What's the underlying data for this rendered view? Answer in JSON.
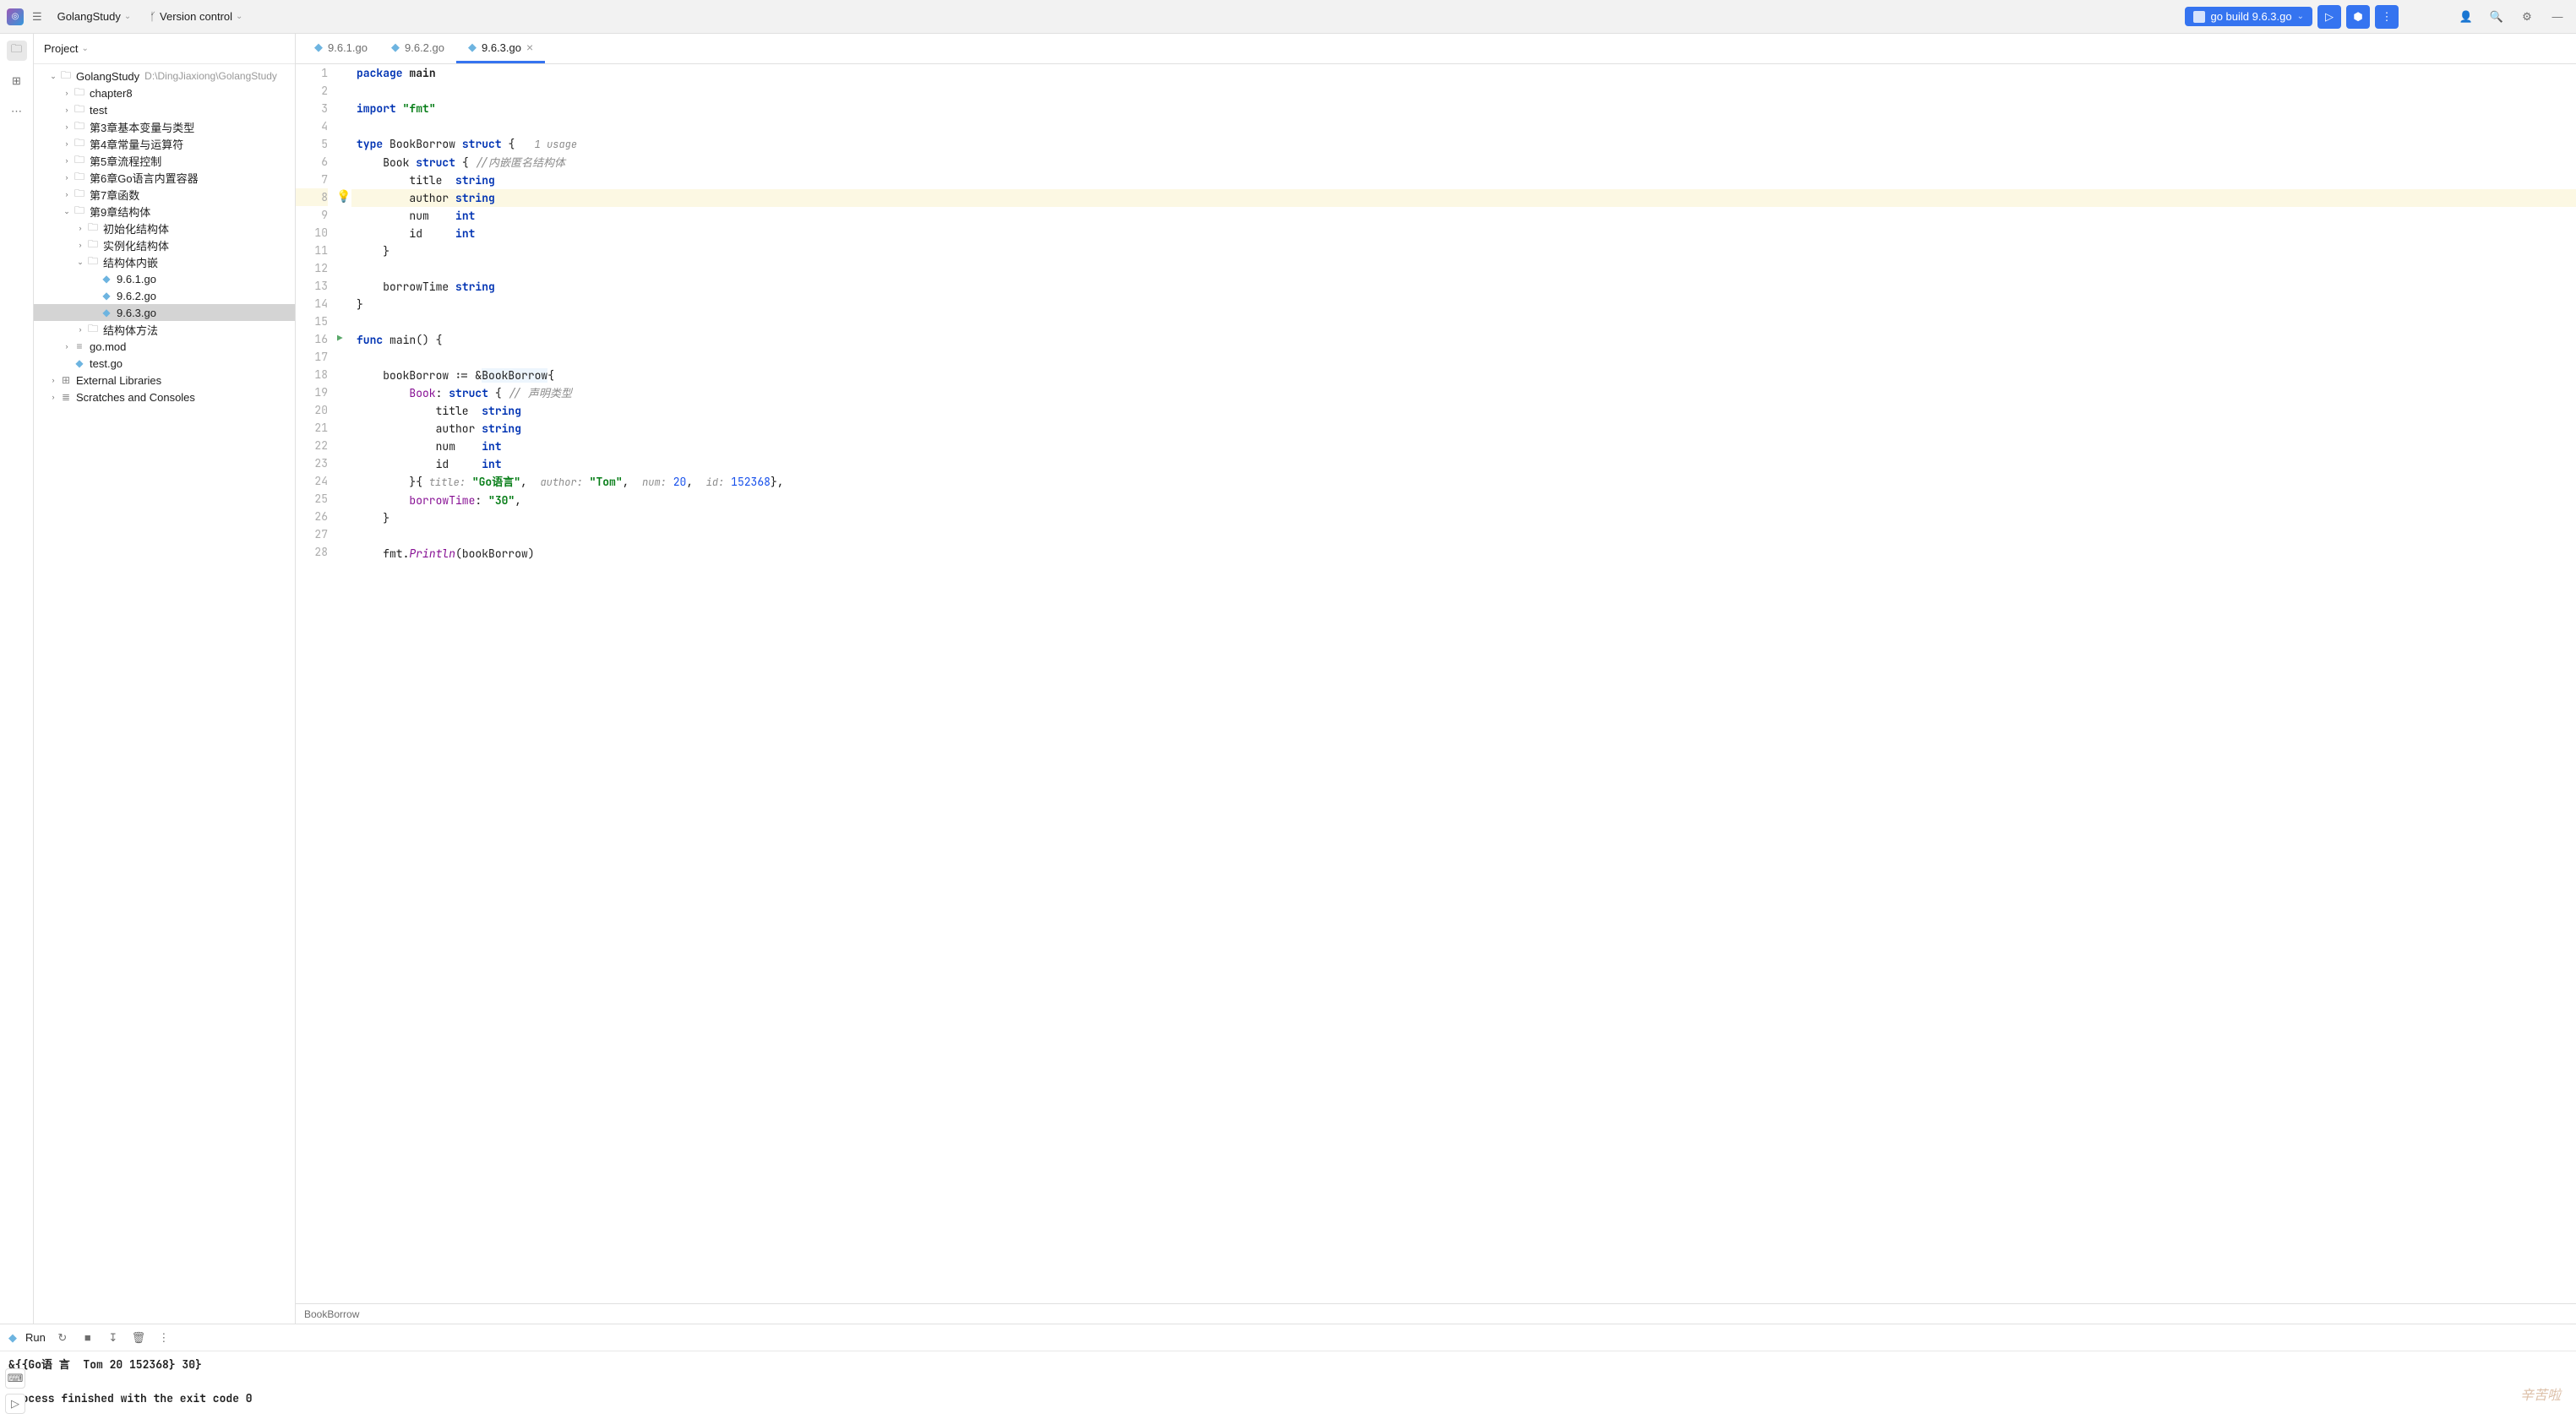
{
  "toolbar": {
    "project_name": "GolangStudy",
    "vcs_label": "Version control",
    "run_config": "go build 9.6.3.go"
  },
  "project_panel": {
    "title": "Project",
    "root": {
      "name": "GolangStudy",
      "path": "D:\\DingJiaxiong\\GolangStudy"
    },
    "tree": [
      {
        "depth": 1,
        "arrow": "v",
        "icon": "folder",
        "label": "GolangStudy",
        "hint": "D:\\DingJiaxiong\\GolangStudy"
      },
      {
        "depth": 2,
        "arrow": ">",
        "icon": "folder",
        "label": "chapter8"
      },
      {
        "depth": 2,
        "arrow": ">",
        "icon": "folder",
        "label": "test"
      },
      {
        "depth": 2,
        "arrow": ">",
        "icon": "folder",
        "label": "第3章基本变量与类型"
      },
      {
        "depth": 2,
        "arrow": ">",
        "icon": "folder",
        "label": "第4章常量与运算符"
      },
      {
        "depth": 2,
        "arrow": ">",
        "icon": "folder",
        "label": "第5章流程控制"
      },
      {
        "depth": 2,
        "arrow": ">",
        "icon": "folder",
        "label": "第6章Go语言内置容器"
      },
      {
        "depth": 2,
        "arrow": ">",
        "icon": "folder",
        "label": "第7章函数"
      },
      {
        "depth": 2,
        "arrow": "v",
        "icon": "folder",
        "label": "第9章结构体"
      },
      {
        "depth": 3,
        "arrow": ">",
        "icon": "folder",
        "label": "初始化结构体"
      },
      {
        "depth": 3,
        "arrow": ">",
        "icon": "folder",
        "label": "实例化结构体"
      },
      {
        "depth": 3,
        "arrow": "v",
        "icon": "folder",
        "label": "结构体内嵌"
      },
      {
        "depth": 4,
        "arrow": "",
        "icon": "go",
        "label": "9.6.1.go"
      },
      {
        "depth": 4,
        "arrow": "",
        "icon": "go",
        "label": "9.6.2.go"
      },
      {
        "depth": 4,
        "arrow": "",
        "icon": "go",
        "label": "9.6.3.go",
        "selected": true
      },
      {
        "depth": 3,
        "arrow": ">",
        "icon": "folder",
        "label": "结构体方法"
      },
      {
        "depth": 2,
        "arrow": ">",
        "icon": "mod",
        "label": "go.mod"
      },
      {
        "depth": 2,
        "arrow": "",
        "icon": "go",
        "label": "test.go"
      },
      {
        "depth": 1,
        "arrow": ">",
        "icon": "lib",
        "label": "External Libraries"
      },
      {
        "depth": 1,
        "arrow": ">",
        "icon": "scratch",
        "label": "Scratches and Consoles"
      }
    ]
  },
  "tabs": [
    {
      "label": "9.6.1.go",
      "active": false
    },
    {
      "label": "9.6.2.go",
      "active": false
    },
    {
      "label": "9.6.3.go",
      "active": true
    }
  ],
  "code": {
    "lines": [
      {
        "n": 1,
        "html": "<span class='kw'>package</span> <span class='pkg'>main</span>"
      },
      {
        "n": 2,
        "html": ""
      },
      {
        "n": 3,
        "html": "<span class='kw'>import</span> <span class='str'>\"fmt\"</span>"
      },
      {
        "n": 4,
        "html": ""
      },
      {
        "n": 5,
        "html": "<span class='kw'>type</span> <span class='ident'>BookBorrow</span> <span class='kw'>struct</span> {   <span class='hint'>1 usage</span>"
      },
      {
        "n": 6,
        "html": "    <span class='ident'>Book</span> <span class='kw'>struct</span> { <span class='comm'>//内嵌匿名结构体</span>"
      },
      {
        "n": 7,
        "html": "        <span class='ident'>title</span>  <span class='type'>string</span>"
      },
      {
        "n": 8,
        "html": "        <span class='ident'>author</span> <span class='type'>string</span>",
        "hl": true,
        "bulb": true
      },
      {
        "n": 9,
        "html": "        <span class='ident'>num</span>    <span class='type'>int</span>"
      },
      {
        "n": 10,
        "html": "        <span class='ident'>id</span>     <span class='type'>int</span>"
      },
      {
        "n": 11,
        "html": "    }"
      },
      {
        "n": 12,
        "html": ""
      },
      {
        "n": 13,
        "html": "    <span class='ident'>borrowTime</span> <span class='type'>string</span>"
      },
      {
        "n": 14,
        "html": "}"
      },
      {
        "n": 15,
        "html": ""
      },
      {
        "n": 16,
        "html": "<span class='kw'>func</span> <span class='ident'>main</span>() {",
        "run": true
      },
      {
        "n": 17,
        "html": ""
      },
      {
        "n": 18,
        "html": "    <span class='ident'>bookBorrow</span> := &amp;<span class='structname'>BookBorrow</span>{"
      },
      {
        "n": 19,
        "html": "        <span class='field'>Book</span>: <span class='kw'>struct</span> { <span class='comm'>// 声明类型</span>"
      },
      {
        "n": 20,
        "html": "            <span class='ident'>title</span>  <span class='type'>string</span>"
      },
      {
        "n": 21,
        "html": "            <span class='ident'>author</span> <span class='type'>string</span>"
      },
      {
        "n": 22,
        "html": "            <span class='ident'>num</span>    <span class='type'>int</span>"
      },
      {
        "n": 23,
        "html": "            <span class='ident'>id</span>     <span class='type'>int</span>"
      },
      {
        "n": 24,
        "html": "        }{ <span class='hint'>title:</span> <span class='str'>\"Go语言\"</span>,  <span class='hint'>author:</span> <span class='str'>\"Tom\"</span>,  <span class='hint'>num:</span> <span class='num'>20</span>,  <span class='hint'>id:</span> <span class='num'>152368</span>},"
      },
      {
        "n": 25,
        "html": "        <span class='field'>borrowTime</span>: <span class='str'>\"30\"</span>,"
      },
      {
        "n": 26,
        "html": "    }"
      },
      {
        "n": 27,
        "html": ""
      },
      {
        "n": 28,
        "html": "    <span class='ident'>fmt</span>.<span class='fn'>Println</span>(bookBorrow)"
      }
    ]
  },
  "breadcrumb": "BookBorrow",
  "run_panel": {
    "title": "Run",
    "output_line1": "&{{Go语 言  Tom 20 152368} 30}",
    "output_line2": "",
    "output_line3": "Process finished with the exit code 0"
  },
  "watermark": "辛苦啦"
}
